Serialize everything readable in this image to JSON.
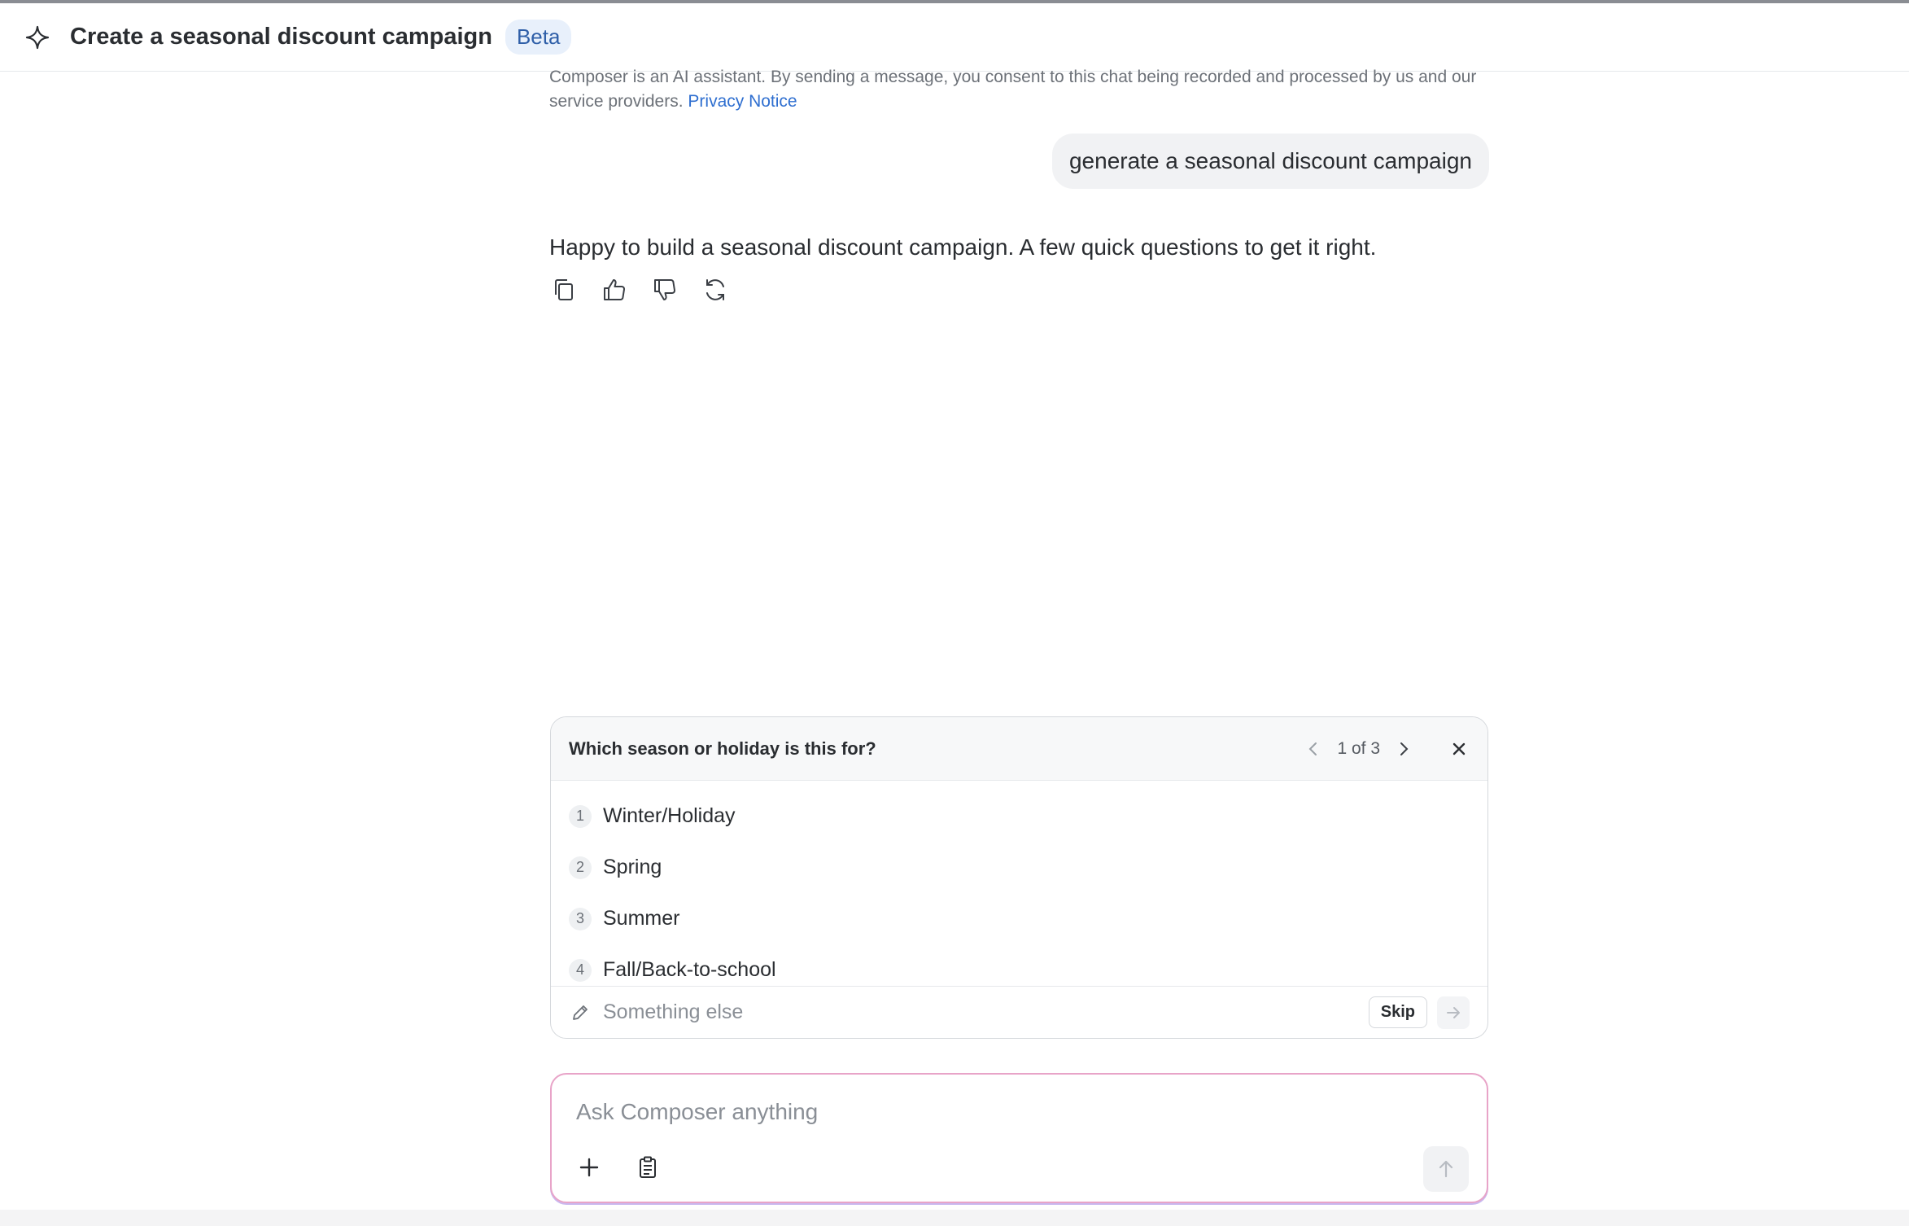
{
  "header": {
    "title": "Create a seasonal discount campaign",
    "badge": "Beta"
  },
  "disclaimer": {
    "text": "Composer is an AI assistant. By sending a message, you consent to this chat being recorded and processed by us and our service providers.",
    "link": "Privacy Notice"
  },
  "messages": {
    "user": "generate a seasonal discount campaign",
    "assistant": "Happy to build a seasonal discount campaign. A few quick questions to get it right."
  },
  "message_actions": [
    "copy-icon",
    "thumbs-up-icon",
    "thumbs-down-icon",
    "regenerate-icon"
  ],
  "question": {
    "title": "Which season or holiday is this for?",
    "pager": "1 of 3",
    "options": [
      {
        "num": "1",
        "label": "Winter/Holiday"
      },
      {
        "num": "2",
        "label": "Spring"
      },
      {
        "num": "3",
        "label": "Summer"
      },
      {
        "num": "4",
        "label": "Fall/Back-to-school"
      }
    ],
    "other_placeholder": "Something else",
    "skip_label": "Skip"
  },
  "composer": {
    "placeholder": "Ask Composer anything"
  },
  "colors": {
    "accent_link": "#2f6fd0",
    "badge_bg": "#e8f0fb",
    "composer_border": "#e8a4c8"
  }
}
